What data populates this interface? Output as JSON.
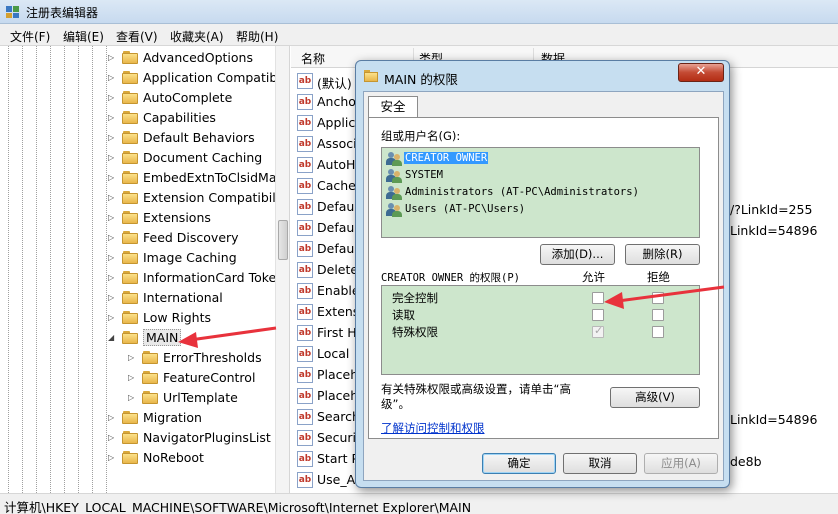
{
  "window": {
    "title": "注册表编辑器"
  },
  "menu": [
    "文件(F)",
    "编辑(E)",
    "查看(V)",
    "收藏夹(A)",
    "帮助(H)"
  ],
  "tree": {
    "items": [
      {
        "label": "AdvancedOptions",
        "level": 0
      },
      {
        "label": "Application Compatib",
        "level": 0
      },
      {
        "label": "AutoComplete",
        "level": 0
      },
      {
        "label": "Capabilities",
        "level": 0
      },
      {
        "label": "Default Behaviors",
        "level": 0
      },
      {
        "label": "Document Caching",
        "level": 0
      },
      {
        "label": "EmbedExtnToClsidMa",
        "level": 0
      },
      {
        "label": "Extension Compatibili",
        "level": 0
      },
      {
        "label": "Extensions",
        "level": 0
      },
      {
        "label": "Feed Discovery",
        "level": 0
      },
      {
        "label": "Image Caching",
        "level": 0
      },
      {
        "label": "InformationCard Toke",
        "level": 0
      },
      {
        "label": "International",
        "level": 0
      },
      {
        "label": "Low Rights",
        "level": 0
      },
      {
        "label": "MAIN",
        "level": 0,
        "expanded": true,
        "selected": true
      },
      {
        "label": "ErrorThresholds",
        "level": 1
      },
      {
        "label": "FeatureControl",
        "level": 1
      },
      {
        "label": "UrlTemplate",
        "level": 1
      },
      {
        "label": "Migration",
        "level": 0
      },
      {
        "label": "NavigatorPluginsList",
        "level": 0
      },
      {
        "label": "NoReboot",
        "level": 0
      }
    ]
  },
  "list": {
    "headers": [
      "名称",
      "类型",
      "数据"
    ],
    "rows": [
      "(默认)",
      "Ancho",
      "Applic",
      "Associ",
      "AutoH",
      "Cache",
      "Defaul",
      "Defaul",
      "Defaul",
      "Delete",
      "Enable",
      "Extens",
      "First H",
      "Local",
      "Placeh",
      "Placeh",
      "Search",
      "Securi",
      "Start P",
      "Use_A"
    ],
    "data_fragments": [
      "/?LinkId=255",
      "LinkId=54896",
      "LinkId=54896",
      "de8b"
    ]
  },
  "status": "计算机\\HKEY_LOCAL_MACHINE\\SOFTWARE\\Microsoft\\Internet Explorer\\MAIN",
  "dialog": {
    "title": "MAIN 的权限",
    "close_label": "✕",
    "tab_label": "安全",
    "group_label": "组或用户名(G):",
    "users": [
      {
        "name": "CREATOR OWNER",
        "selected": true
      },
      {
        "name": "SYSTEM",
        "selected": false
      },
      {
        "name": "Administrators (AT-PC\\Administrators)",
        "selected": false
      },
      {
        "name": "Users (AT-PC\\Users)",
        "selected": false
      }
    ],
    "add_button": "添加(D)...",
    "remove_button": "删除(R)",
    "perm_header": "CREATOR OWNER 的权限(P)",
    "allow_label": "允许",
    "deny_label": "拒绝",
    "permissions": [
      {
        "name": "完全控制",
        "allow": false,
        "deny": false
      },
      {
        "name": "读取",
        "allow": false,
        "deny": false
      },
      {
        "name": "特殊权限",
        "allow": true,
        "deny": false
      }
    ],
    "advanced_note_line1": "有关特殊权限或高级设置，请单击“高",
    "advanced_note_line2": "级”。",
    "advanced_button": "高级(V)",
    "learn_link": "了解访问控制和权限",
    "ok_button": "确定",
    "cancel_button": "取消",
    "apply_button": "应用(A)"
  },
  "colors": {
    "annotation_arrow": "#e8323c",
    "dialog_frame": "#c6def0",
    "list_highlight": "#cde6cc"
  }
}
